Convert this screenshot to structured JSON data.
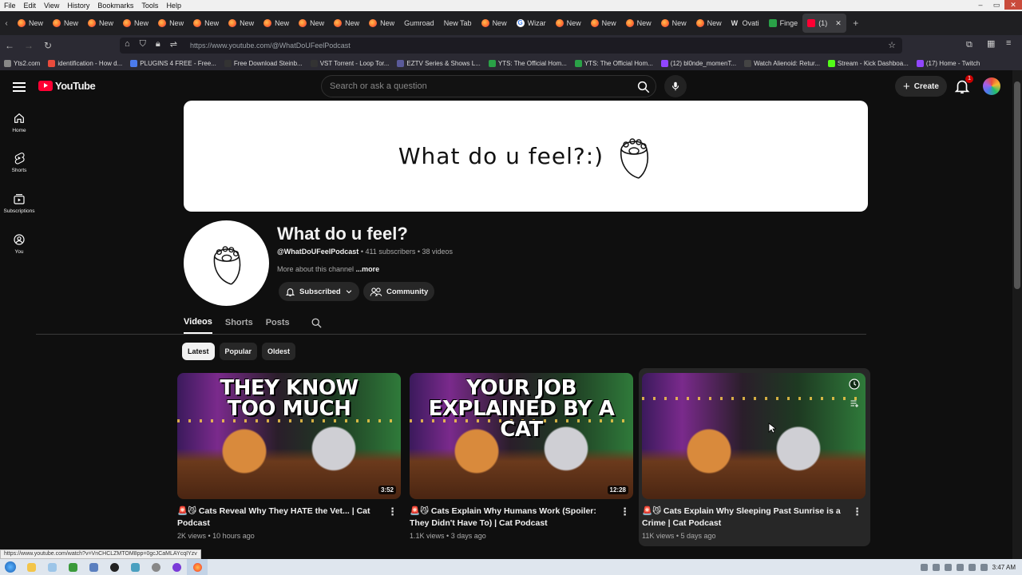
{
  "menu": [
    "File",
    "Edit",
    "View",
    "History",
    "Bookmarks",
    "Tools",
    "Help"
  ],
  "tabs": [
    {
      "label": "New",
      "icon": "ff"
    },
    {
      "label": "New",
      "icon": "ff"
    },
    {
      "label": "New",
      "icon": "ff"
    },
    {
      "label": "New",
      "icon": "ff"
    },
    {
      "label": "New",
      "icon": "ff"
    },
    {
      "label": "New",
      "icon": "ff"
    },
    {
      "label": "New",
      "icon": "ff"
    },
    {
      "label": "New",
      "icon": "ff"
    },
    {
      "label": "New",
      "icon": "ff"
    },
    {
      "label": "New",
      "icon": "ff"
    },
    {
      "label": "New",
      "icon": "ff"
    },
    {
      "label": "Gumroad",
      "icon": "none"
    },
    {
      "label": "New Tab",
      "icon": "none"
    },
    {
      "label": "New",
      "icon": "ff"
    },
    {
      "label": "Wizar",
      "icon": "g"
    },
    {
      "label": "New",
      "icon": "ff"
    },
    {
      "label": "New",
      "icon": "ff"
    },
    {
      "label": "New",
      "icon": "ff"
    },
    {
      "label": "New",
      "icon": "ff"
    },
    {
      "label": "New",
      "icon": "ff"
    },
    {
      "label": "Ovati",
      "icon": "w"
    },
    {
      "label": "Finge",
      "icon": "fv"
    },
    {
      "label": "(1)",
      "icon": "yt",
      "active": true
    }
  ],
  "url": "https://www.youtube.com/@WhatDoUFeelPodcast",
  "bookmarks": [
    {
      "label": "Yts2.com",
      "color": "#888888"
    },
    {
      "label": "identification - How d...",
      "color": "#e94b3c"
    },
    {
      "label": "PLUGINS 4 FREE - Free...",
      "color": "#4b7bec"
    },
    {
      "label": "Free Download Steinb...",
      "color": "#333333"
    },
    {
      "label": "VST Torrent - Loop Tor...",
      "color": "#333333"
    },
    {
      "label": "EZTV Series & Shows L...",
      "color": "#5a5a9a"
    },
    {
      "label": "YTS: The Official Hom...",
      "color": "#2aa147"
    },
    {
      "label": "YTS: The Official Hom...",
      "color": "#2aa147"
    },
    {
      "label": "(12) bl0nde_momenT...",
      "color": "#9146ff"
    },
    {
      "label": "Watch Alienoid: Retur...",
      "color": "#444444"
    },
    {
      "label": "Stream - Kick Dashboa...",
      "color": "#53fc18"
    },
    {
      "label": "(17) Home - Twitch",
      "color": "#9146ff"
    }
  ],
  "yt": {
    "logo": "YouTube",
    "search_placeholder": "Search or ask a question",
    "create_label": "Create",
    "notification_count": "1",
    "sidebar": [
      {
        "label": "Home",
        "icon": "home-icon"
      },
      {
        "label": "Shorts",
        "icon": "shorts-icon"
      },
      {
        "label": "Subscriptions",
        "icon": "subscriptions-icon"
      },
      {
        "label": "You",
        "icon": "you-icon"
      }
    ],
    "banner_text": "What do u feel?:)",
    "channel": {
      "name": "What do u feel?",
      "handle": "@WhatDoUFeelPodcast",
      "subscribers": "411 subscribers",
      "videos": "38 videos",
      "about": "More about this channel",
      "more": "...more",
      "subscribed_label": "Subscribed",
      "community_label": "Community"
    },
    "channel_tabs": [
      {
        "label": "Videos",
        "active": true
      },
      {
        "label": "Shorts"
      },
      {
        "label": "Posts"
      }
    ],
    "filters": [
      {
        "label": "Latest",
        "active": true
      },
      {
        "label": "Popular"
      },
      {
        "label": "Oldest"
      }
    ],
    "videos": [
      {
        "thumb_text": "THEY KNOW TOO MUCH",
        "duration": "3:52",
        "title": "🚨😼 Cats Reveal Why They HATE the Vet... | Cat Podcast",
        "views": "2K views",
        "age": "10 hours ago"
      },
      {
        "thumb_text": "YOUR JOB EXPLAINED BY A CAT",
        "duration": "12:28",
        "title": "🚨😼 Cats Explain Why Humans Work (Spoiler: They Didn't Have To) | Cat Podcast",
        "views": "1.1K views",
        "age": "3 days ago"
      },
      {
        "thumb_text": "",
        "duration": "",
        "title": "🚨😼 Cats Explain Why Sleeping Past Sunrise is a Crime | Cat Podcast",
        "views": "11K views",
        "age": "5 days ago",
        "hovered": true
      }
    ]
  },
  "status_url": "https://www.youtube.com/watch?v=VnCHCLZMTOM8pp=0gcJCaMLAYcqIYzv",
  "clock": "3:47 AM"
}
